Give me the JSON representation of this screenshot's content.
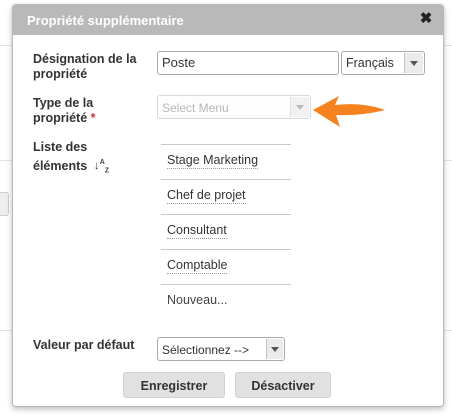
{
  "dialog": {
    "title": "Propriété supplémentaire",
    "close_label": "✖"
  },
  "designation": {
    "label": "Désignation de la propriété",
    "value": "Poste",
    "language": "Français"
  },
  "type": {
    "label": "Type de la propriété",
    "required_marker": "*",
    "placeholder": "Select Menu"
  },
  "list": {
    "label": "Liste des éléments",
    "sort_icon": "sort-alpha-icon",
    "items": [
      "Stage Marketing",
      "Chef de projet",
      "Consultant",
      "Comptable"
    ],
    "new_item": "Nouveau..."
  },
  "default_value": {
    "label": "Valeur par défaut",
    "selected": "Sélectionnez -->"
  },
  "buttons": {
    "save": "Enregistrer",
    "deactivate": "Désactiver"
  },
  "colors": {
    "titlebar": "#b9b9b9",
    "annotation_arrow": "#f5821f",
    "required": "#d03030"
  }
}
